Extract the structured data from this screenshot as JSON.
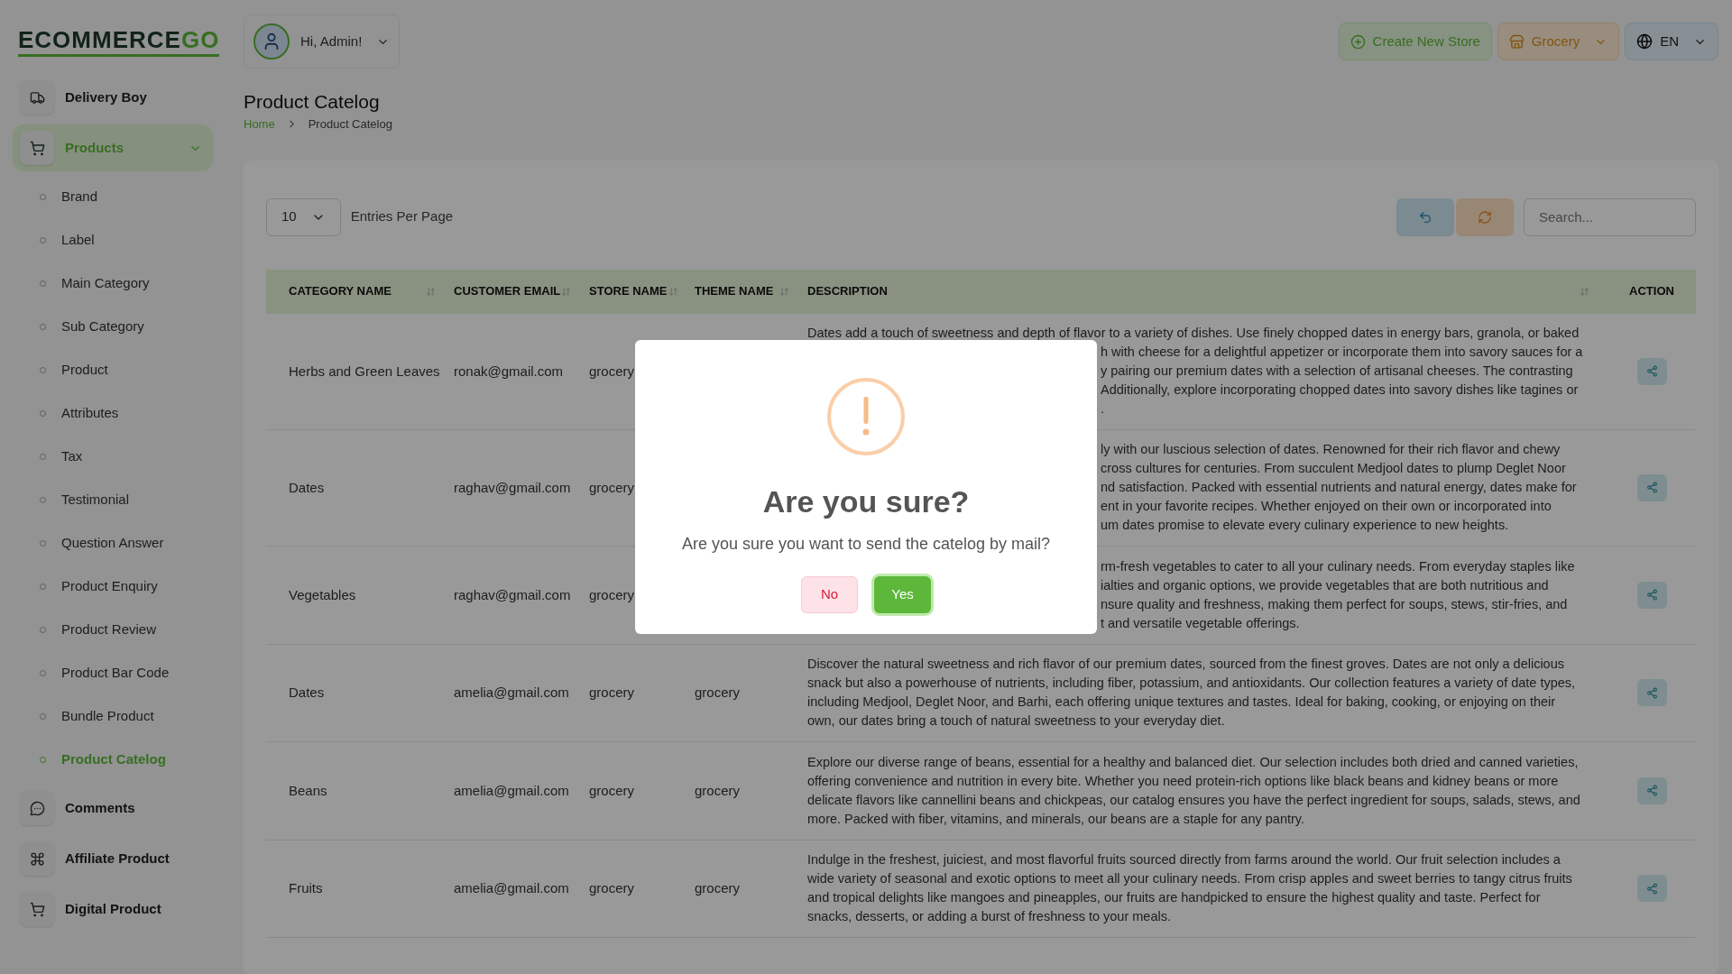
{
  "logo": {
    "text": "ECOMMERCE",
    "accent": "GO"
  },
  "user_menu": {
    "greeting": "Hi, Admin!"
  },
  "header_actions": [
    {
      "label": "Create New Store",
      "kind": "create"
    },
    {
      "label": "Grocery",
      "kind": "store"
    },
    {
      "label": "EN",
      "kind": "language"
    }
  ],
  "sidebar": {
    "items": [
      {
        "label": "Delivery Boy",
        "selected": false
      },
      {
        "label": "Products",
        "selected": true,
        "expanded": true,
        "children": [
          {
            "label": "Brand",
            "selected": false
          },
          {
            "label": "Label",
            "selected": false
          },
          {
            "label": "Main Category",
            "selected": false
          },
          {
            "label": "Sub Category",
            "selected": false
          },
          {
            "label": "Product",
            "selected": false
          },
          {
            "label": "Attributes",
            "selected": false
          },
          {
            "label": "Tax",
            "selected": false
          },
          {
            "label": "Testimonial",
            "selected": false
          },
          {
            "label": "Question Answer",
            "selected": false
          },
          {
            "label": "Product Enquiry",
            "selected": false
          },
          {
            "label": "Product Review",
            "selected": false
          },
          {
            "label": "Product Bar Code",
            "selected": false
          },
          {
            "label": "Bundle Product",
            "selected": false
          },
          {
            "label": "Product Catelog",
            "selected": true
          }
        ]
      },
      {
        "label": "Comments",
        "selected": false
      },
      {
        "label": "Affiliate Product",
        "selected": false
      },
      {
        "label": "Digital Product",
        "selected": false
      }
    ]
  },
  "page": {
    "title": "Product Catelog",
    "breadcrumb": [
      "Home",
      "Product Catelog"
    ]
  },
  "table_controls": {
    "entries": "10",
    "entries_label": "Entries Per Page",
    "search_placeholder": "Search..."
  },
  "table": {
    "columns": [
      {
        "label": "CATEGORY NAME",
        "sortable": true
      },
      {
        "label": "CUSTOMER EMAIL",
        "sortable": true
      },
      {
        "label": "STORE NAME",
        "sortable": true
      },
      {
        "label": "THEME NAME",
        "sortable": true
      },
      {
        "label": "DESCRIPTION",
        "sortable": true
      },
      {
        "label": "ACTION",
        "sortable": false
      }
    ],
    "rows": [
      {
        "category": "Herbs and Green Leaves",
        "email": "ronak@gmail.com",
        "store": "grocery",
        "description": [
          {
            "kind": "full",
            "text": "Dates add a touch of sweetness and depth of flavor to a variety of dishes. Use finely chopped dates in energy bars, granola, or baked"
          },
          {
            "kind": "tail",
            "text": "h with cheese for a delightful appetizer or incorporate them into savory sauces for a"
          },
          {
            "kind": "tail",
            "text": "y pairing our premium dates with a selection of artisanal cheeses. The contrasting"
          },
          {
            "kind": "tail",
            "text": "Additionally, explore incorporating chopped dates into savory dishes like tagines or"
          },
          {
            "kind": "tail",
            "text": "."
          }
        ]
      },
      {
        "category": "Dates",
        "email": "raghav@gmail.com",
        "store": "grocery",
        "description": [
          {
            "kind": "tail",
            "text": "ly with our luscious selection of dates. Renowned for their rich flavor and chewy"
          },
          {
            "kind": "tail",
            "text": "cross cultures for centuries. From succulent Medjool dates to plump Deglet Noor"
          },
          {
            "kind": "tail",
            "text": "nd satisfaction. Packed with essential nutrients and natural energy, dates make for"
          },
          {
            "kind": "tail",
            "text": "ent in your favorite recipes. Whether enjoyed on their own or incorporated into"
          },
          {
            "kind": "tail",
            "text": "um dates promise to elevate every culinary experience to new heights."
          }
        ]
      },
      {
        "category": "Vegetables",
        "email": "raghav@gmail.com",
        "store": "grocery",
        "description": [
          {
            "kind": "tail",
            "text": "rm-fresh vegetables to cater to all your culinary needs. From everyday staples like"
          },
          {
            "kind": "tail",
            "text": "ialties and organic options, we provide vegetables that are both nutritious and"
          },
          {
            "kind": "tail",
            "text": "nsure quality and freshness, making them perfect for soups, stews, stir-fries, and"
          },
          {
            "kind": "tail",
            "text": "t and versatile vegetable offerings."
          }
        ]
      },
      {
        "category": "Dates",
        "email": "amelia@gmail.com",
        "store": "grocery",
        "theme": "grocery",
        "description": [
          {
            "kind": "full",
            "text": "Discover the natural sweetness and rich flavor of our premium dates, sourced from the finest groves. Dates are not only a delicious"
          },
          {
            "kind": "full",
            "text": "snack but also a powerhouse of nutrients, including fiber, potassium, and antioxidants. Our collection features a variety of date types,"
          },
          {
            "kind": "full",
            "text": "including Medjool, Deglet Noor, and Barhi, each offering unique textures and tastes. Ideal for baking, cooking, or enjoying on their"
          },
          {
            "kind": "full",
            "text": "own, our dates bring a touch of natural sweetness to your everyday diet."
          }
        ]
      },
      {
        "category": "Beans",
        "email": "amelia@gmail.com",
        "store": "grocery",
        "theme": "grocery",
        "description": [
          {
            "kind": "full",
            "text": "Explore our diverse range of beans, essential for a healthy and balanced diet. Our selection includes both dried and canned varieties,"
          },
          {
            "kind": "full",
            "text": "offering convenience and nutrition in every bite. Whether you need protein-rich options like black beans and kidney beans or more"
          },
          {
            "kind": "full",
            "text": "delicate flavors like cannellini beans and chickpeas, our catalog ensures you have the perfect ingredient for soups, salads, stews, and"
          },
          {
            "kind": "full",
            "text": "more. Packed with fiber, vitamins, and minerals, our beans are a staple for any pantry."
          }
        ]
      },
      {
        "category": "Fruits",
        "email": "amelia@gmail.com",
        "store": "grocery",
        "theme": "grocery",
        "description": [
          {
            "kind": "full",
            "text": "Indulge in the freshest, juiciest, and most flavorful fruits sourced directly from farms around the world. Our fruit selection includes a"
          },
          {
            "kind": "full",
            "text": "wide variety of seasonal and exotic options to meet all your culinary needs. From crisp apples and sweet berries to tangy citrus fruits"
          },
          {
            "kind": "full",
            "text": "and tropical delights like mangoes and pineapples, our fruits are handpicked to ensure the highest quality and taste. Perfect for"
          },
          {
            "kind": "full",
            "text": "snacks, desserts, or adding a burst of freshness to your meals."
          }
        ]
      }
    ]
  },
  "dialog": {
    "title": "Are you sure?",
    "message": "Are you sure you want to send the catelog by mail?",
    "buttons": [
      {
        "label": "No",
        "kind": "cancel"
      },
      {
        "label": "Yes",
        "kind": "confirm"
      }
    ]
  }
}
